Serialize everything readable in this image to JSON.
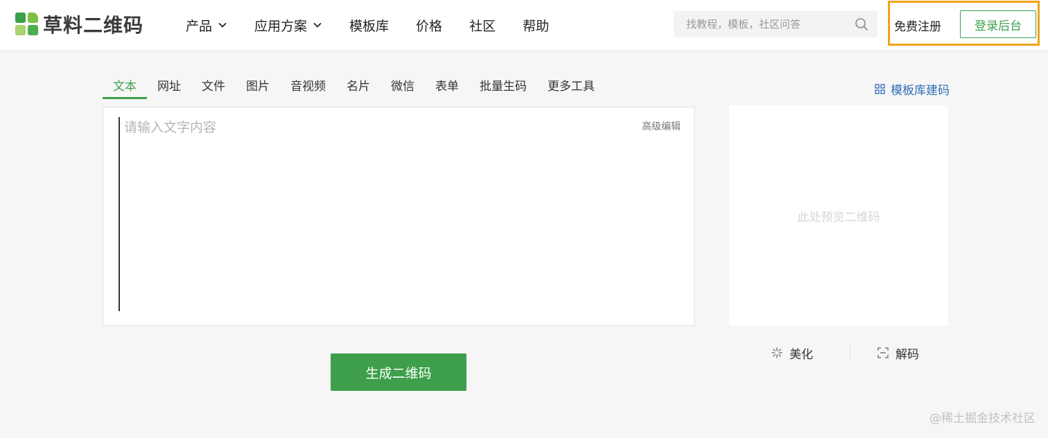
{
  "header": {
    "logo_text": "草料二维码",
    "logo_colors": [
      "#3d9f4b",
      "#7cc143",
      "#a9d36c",
      "#4caf50"
    ],
    "nav": [
      {
        "label": "产品",
        "dropdown": true
      },
      {
        "label": "应用方案",
        "dropdown": true
      },
      {
        "label": "模板库",
        "dropdown": false
      },
      {
        "label": "价格",
        "dropdown": false
      },
      {
        "label": "社区",
        "dropdown": false
      },
      {
        "label": "帮助",
        "dropdown": false
      }
    ],
    "search": {
      "placeholder": "找教程，模板，社区问答",
      "value": "",
      "icon": "search-icon"
    },
    "register_label": "免费注册",
    "login_label": "登录后台",
    "highlight_color": "#f0a318"
  },
  "tabs": [
    {
      "label": "文本",
      "active": true
    },
    {
      "label": "网址",
      "active": false
    },
    {
      "label": "文件",
      "active": false
    },
    {
      "label": "图片",
      "active": false
    },
    {
      "label": "音视频",
      "active": false
    },
    {
      "label": "名片",
      "active": false
    },
    {
      "label": "微信",
      "active": false
    },
    {
      "label": "表单",
      "active": false
    },
    {
      "label": "批量生码",
      "active": false
    },
    {
      "label": "更多工具",
      "active": false
    }
  ],
  "template_link": {
    "label": "模板库建码",
    "icon": "grid-icon"
  },
  "editor": {
    "placeholder": "请输入文字内容",
    "value": "",
    "advanced_label": "高级编辑"
  },
  "preview": {
    "placeholder": "此处预览二维码"
  },
  "generate_label": "生成二维码",
  "preview_actions": {
    "beautify_label": "美化",
    "beautify_icon": "sparkle-icon",
    "decode_label": "解码",
    "decode_icon": "scan-icon"
  },
  "watermark": "@稀土掘金技术社区",
  "colors": {
    "accent": "#3d9f4b",
    "link": "#2f6db5"
  }
}
